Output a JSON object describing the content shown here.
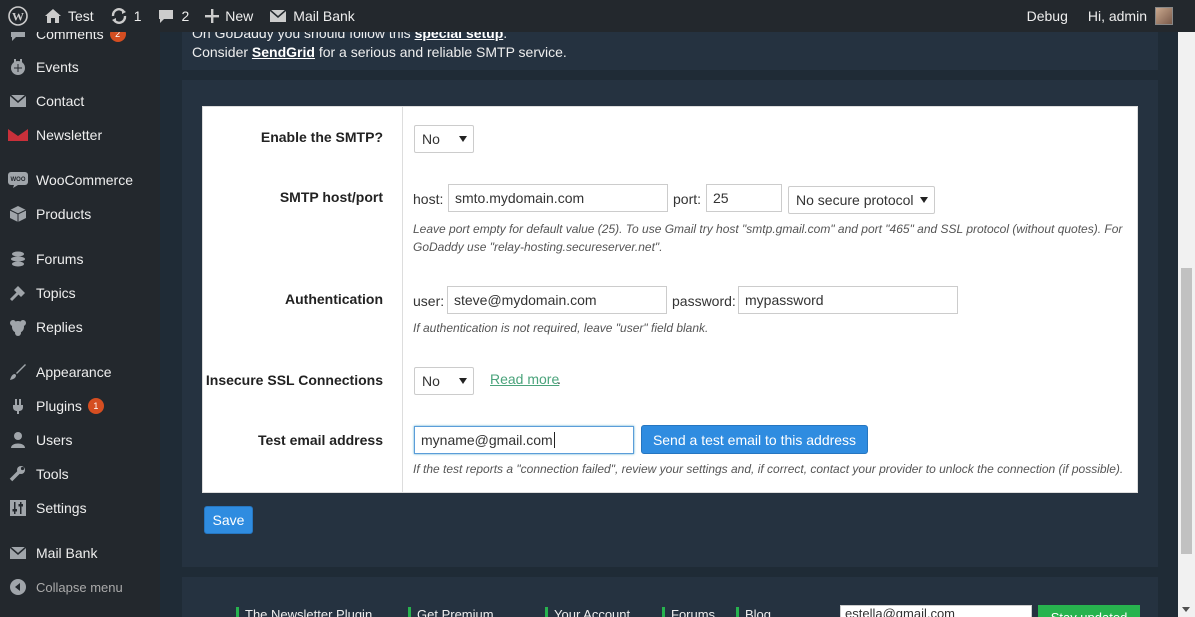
{
  "adminbar": {
    "site_name": "Test",
    "updates_count": "1",
    "comments_count": "2",
    "new_label": "New",
    "plugin_label": "Mail Bank",
    "debug_label": "Debug",
    "greeting": "Hi, admin"
  },
  "sidebar": {
    "items": [
      {
        "label": "Comments",
        "badge": "2",
        "icon": "comments-icon"
      },
      {
        "label": "Events",
        "icon": "calendar-icon"
      },
      {
        "label": "Contact",
        "icon": "envelope-icon"
      },
      {
        "label": "Newsletter",
        "icon": "newsletter-icon"
      },
      {
        "label": "WooCommerce",
        "icon": "woocommerce-icon"
      },
      {
        "label": "Products",
        "icon": "box-icon"
      },
      {
        "label": "Forums",
        "icon": "forums-icon"
      },
      {
        "label": "Topics",
        "icon": "topics-icon"
      },
      {
        "label": "Replies",
        "icon": "replies-icon"
      },
      {
        "label": "Appearance",
        "icon": "brush-icon"
      },
      {
        "label": "Plugins",
        "badge": "1",
        "icon": "plug-icon"
      },
      {
        "label": "Users",
        "icon": "user-icon"
      },
      {
        "label": "Tools",
        "icon": "wrench-icon"
      },
      {
        "label": "Settings",
        "icon": "sliders-icon"
      },
      {
        "label": "Mail Bank",
        "icon": "envelope-icon"
      },
      {
        "label": "Collapse menu",
        "icon": "collapse-icon"
      }
    ]
  },
  "notice": {
    "line1_prefix": "On GoDaddy you should follow this ",
    "line1_link": "special setup",
    "line1_suffix": ".",
    "line2_prefix": "Consider ",
    "line2_link": "SendGrid",
    "line2_suffix": " for a serious and reliable SMTP service."
  },
  "form": {
    "enable": {
      "label": "Enable the SMTP?",
      "value": "No"
    },
    "host": {
      "label": "SMTP host/port",
      "host_label": "host:",
      "host_value": "smto.mydomain.com",
      "port_label": "port:",
      "port_value": "25",
      "secure_value": "No secure protocol",
      "help_line1": "Leave port empty for default value (25). To use Gmail try host \"smtp.gmail.com\" and port \"465\" and SSL protocol (without quotes). For",
      "help_line2": "GoDaddy use \"relay-hosting.secureserver.net\"."
    },
    "auth": {
      "label": "Authentication",
      "user_label": "user:",
      "user_value": "steve@mydomain.com",
      "password_label": "password:",
      "password_value": "mypassword",
      "help": "If authentication is not required, leave \"user\" field blank."
    },
    "insecure": {
      "label": "Insecure SSL Connections",
      "value": "No",
      "link": "Read more",
      "link_suffix": "."
    },
    "test": {
      "label": "Test email address",
      "value": "myname@gmail.com",
      "button": "Send a test email to this address",
      "help": "If the test reports a \"connection failed\", review your settings and, if correct, contact your provider to unlock the connection (if possible)."
    },
    "save_label": "Save"
  },
  "footer": {
    "tabs": [
      "The Newsletter Plugin",
      "Get Premium",
      "Your Account",
      "Forums",
      "Blog"
    ],
    "email_placeholder": "estella@gmail.com",
    "button": "Stay updated"
  }
}
